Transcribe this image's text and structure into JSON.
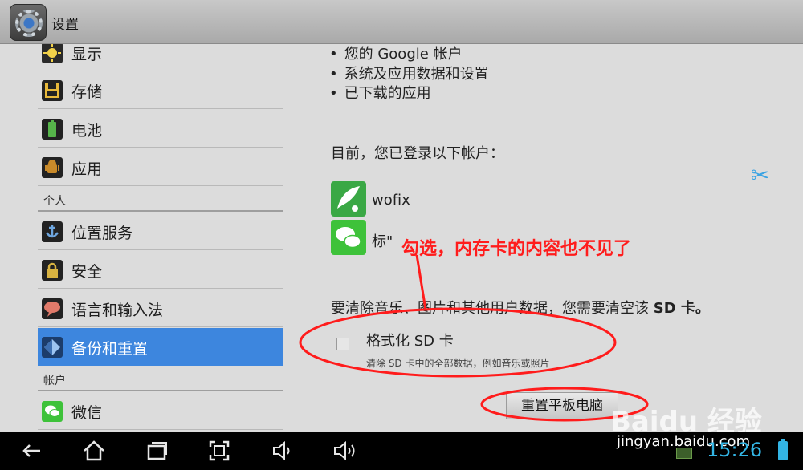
{
  "window": {
    "title": "设置"
  },
  "sidebar": {
    "items_top": [
      {
        "label": "显示",
        "icon": "display-icon"
      },
      {
        "label": "存储",
        "icon": "storage-icon"
      },
      {
        "label": "电池",
        "icon": "battery-icon"
      },
      {
        "label": "应用",
        "icon": "apps-icon"
      }
    ],
    "section_personal": "个人",
    "items_personal": [
      {
        "label": "位置服务",
        "icon": "location-icon"
      },
      {
        "label": "安全",
        "icon": "lock-icon"
      },
      {
        "label": "语言和输入法",
        "icon": "language-icon"
      },
      {
        "label": "备份和重置",
        "icon": "backup-reset-icon",
        "selected": true
      }
    ],
    "section_accounts": "帐户",
    "items_accounts": [
      {
        "label": "微信",
        "icon": "wechat-icon"
      }
    ]
  },
  "content": {
    "bullets": [
      "您的 Google 帐户",
      "系统及应用数据和设置",
      "已下载的应用"
    ],
    "accounts_intro": "目前，您已登录以下帐户：",
    "accounts": [
      {
        "name": "wofix",
        "icon": "wofix-app-icon"
      },
      {
        "name": "标\"",
        "icon": "wechat-icon"
      }
    ],
    "sd_notice_prefix": "要清除音乐、图片和其他用户数据，您需要清空该",
    "sd_notice_bold": "SD 卡。",
    "format_checkbox": {
      "title": "格式化 SD 卡",
      "subtitle": "清除 SD 卡中的全部数据，例如音乐或照片",
      "checked": false
    },
    "reset_button": "重置平板电脑"
  },
  "annotation": {
    "text": "勾选，内存卡的内容也不见了",
    "color": "#ff1c1c"
  },
  "watermark": {
    "logo": "Baidu 经验",
    "url": "jingyan.baidu.com"
  },
  "statusbar": {
    "time": "15:26"
  },
  "navbar": {
    "buttons": [
      "back-icon",
      "home-icon",
      "recent-apps-icon",
      "screenshot-icon",
      "volume-down-icon",
      "volume-up-icon"
    ]
  },
  "colors": {
    "accent": "#33b5e5",
    "selection": "#3d86de",
    "annotation": "#ff1c1c"
  }
}
